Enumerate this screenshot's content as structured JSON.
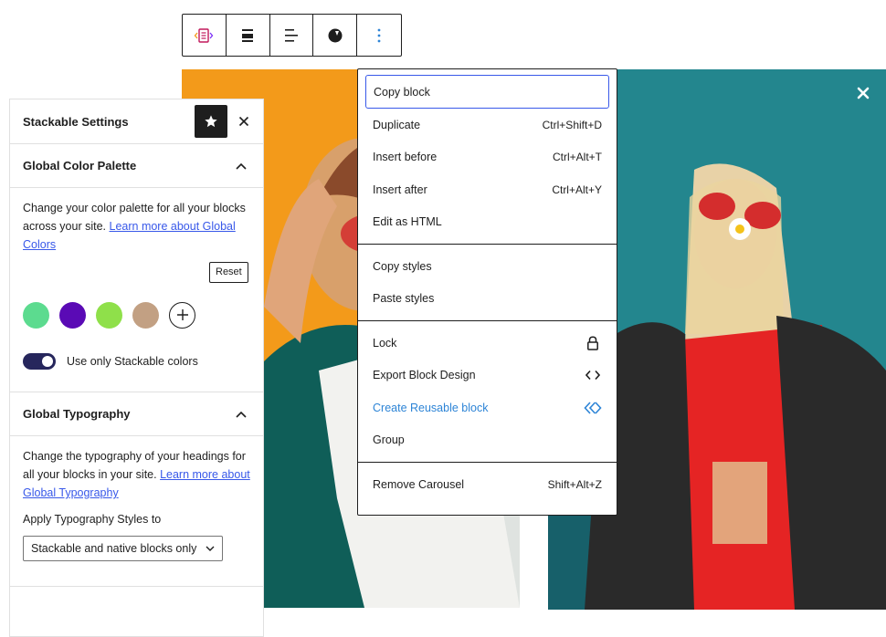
{
  "toolbar": {
    "buttons": [
      {
        "name": "carousel-block-icon"
      },
      {
        "name": "align-center-icon"
      },
      {
        "name": "align-left-icon"
      },
      {
        "name": "stackable-icon"
      },
      {
        "name": "more-options-icon"
      }
    ]
  },
  "colors": {
    "accent": "#3858e9",
    "link_blue": "#2d84d6",
    "toggle": "#26265c",
    "swatches": [
      "#5cdb8f",
      "#5a0ab5",
      "#8fe04a",
      "#c2a083"
    ]
  },
  "panel": {
    "title": "Stackable Settings",
    "color_section": {
      "title": "Global Color Palette",
      "desc_text": "Change your color palette for all your blocks across your site.",
      "link_text": "Learn more about Global Colors",
      "reset_label": "Reset",
      "toggle_label": "Use only Stackable colors"
    },
    "typography_section": {
      "title": "Global Typography",
      "desc_text": "Change the typography of your headings for all your blocks in your site.",
      "link_text": "Learn more about Global Typography",
      "apply_label": "Apply Typography Styles to",
      "select_value": "Stackable and native blocks only"
    }
  },
  "menu": {
    "groups": [
      [
        {
          "label": "Copy block",
          "shortcut": ""
        },
        {
          "label": "Duplicate",
          "shortcut": "Ctrl+Shift+D"
        },
        {
          "label": "Insert before",
          "shortcut": "Ctrl+Alt+T"
        },
        {
          "label": "Insert after",
          "shortcut": "Ctrl+Alt+Y"
        },
        {
          "label": "Edit as HTML",
          "shortcut": ""
        }
      ],
      [
        {
          "label": "Copy styles",
          "shortcut": ""
        },
        {
          "label": "Paste styles",
          "shortcut": ""
        }
      ],
      [
        {
          "label": "Lock",
          "icon": "lock-icon"
        },
        {
          "label": "Export Block Design",
          "icon": "code-icon"
        },
        {
          "label": "Create Reusable block",
          "icon": "reusable-block-icon"
        },
        {
          "label": "Group"
        }
      ],
      [
        {
          "label": "Remove Carousel",
          "shortcut": "Shift+Alt+Z"
        }
      ]
    ]
  }
}
